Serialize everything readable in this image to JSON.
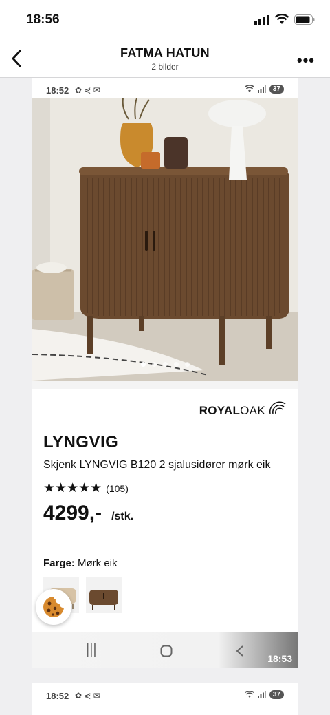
{
  "status_bar": {
    "time": "18:56"
  },
  "header": {
    "title": "FATMA HATUN",
    "subtitle": "2 bilder"
  },
  "screenshot1": {
    "inner_time": "18:52",
    "inner_icons": "✿ ⋞ ✉",
    "battery": "37",
    "product": {
      "brand_a": "ROYAL",
      "brand_b": "OAK",
      "name": "LYNGVIG",
      "description": "Skjenk LYNGVIG B120 2 sjalusidører mørk eik",
      "stars": "★★★★★",
      "review_count": "(105)",
      "price": "4299,-",
      "unit": "/stk.",
      "color_label": "Farge:",
      "color_value": "Mørk eik"
    },
    "nav_time": "18:53"
  },
  "screenshot2": {
    "inner_time": "18:52",
    "inner_icons": "✿ ⋞ ✉",
    "battery": "37"
  },
  "icons": [
    "signal-icon",
    "wifi-icon",
    "battery-icon",
    "back-icon",
    "more-icon",
    "cookie-icon",
    "recents-icon",
    "home-icon",
    "android-back-icon"
  ]
}
